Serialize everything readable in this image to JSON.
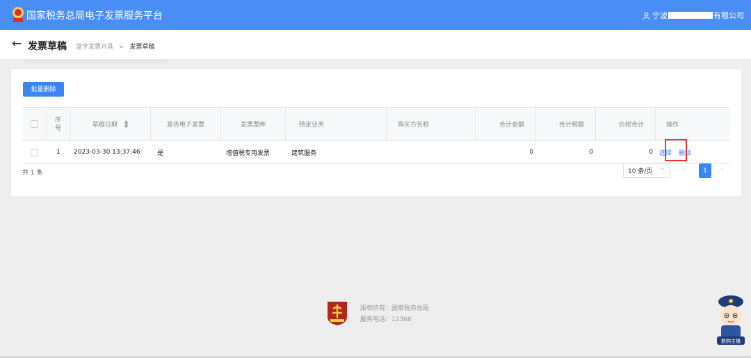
{
  "header": {
    "site_title": "国家税务总局电子发票服务平台",
    "user_prefix": "宁波",
    "user_suffix": "有限公司",
    "brand_color": "#4a8ef5"
  },
  "titlebar": {
    "back_icon": "←",
    "page_title": "发票草稿",
    "breadcrumb": [
      "蓝字发票开具",
      "发票草稿"
    ],
    "breadcrumb_separator": ">"
  },
  "toolbar": {
    "batch_delete_label": "批量删除"
  },
  "table": {
    "columns": [
      "序号",
      "草稿日期",
      "是否电子发票",
      "发票票种",
      "特定业务",
      "购买方名称",
      "合计金额",
      "合计税额",
      "价税合计",
      "操作"
    ],
    "rows": [
      {
        "index": "1",
        "date": "2023-03-30 13:37:46",
        "is_electronic": "是",
        "invoice_type": "增值税专用发票",
        "special_business": "建筑服务",
        "buyer_name": "",
        "total_amount": "0",
        "total_tax": "0",
        "total_with_tax": "0",
        "actions": [
          "选择",
          "删除"
        ]
      }
    ],
    "highlighted_action": "选择"
  },
  "pagination": {
    "total_text": "共 1 条",
    "page_size": "10 条/页",
    "current_page": "1",
    "prev_icon": "‹",
    "next_icon": "›"
  },
  "footer": {
    "copyright": "版权所有：国家税务总局",
    "phone": "服务电话：12366"
  },
  "mascot": {
    "label": "数购主播"
  }
}
